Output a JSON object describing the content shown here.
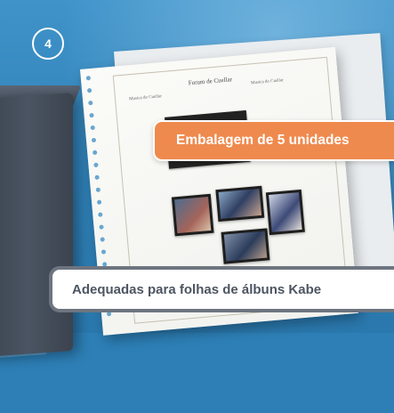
{
  "badge": {
    "number": "4"
  },
  "callouts": {
    "package": "Embalagem de 5 unidades",
    "compatibility": "Adequadas para folhas de álbuns Kabe"
  },
  "album_sheet": {
    "title": "Forum de Cuellar",
    "left_label": "Musica do Cuellar",
    "right_label": "Musica do Cuellar"
  },
  "colors": {
    "background": "#2d7fb6",
    "accent_orange": "#ef8a4e",
    "pill_border": "#6e7580",
    "pill_text": "#4d5561"
  }
}
